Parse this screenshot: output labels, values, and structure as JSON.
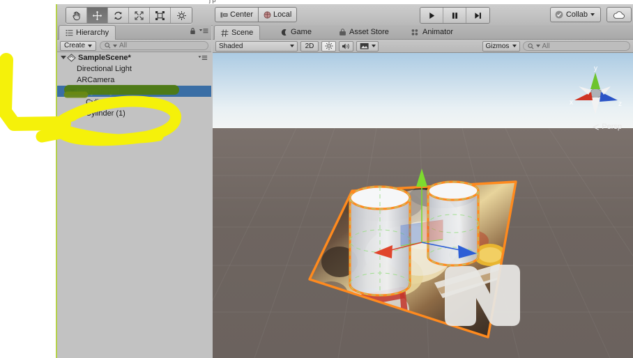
{
  "app": {
    "name": "Unity Editor",
    "ghost_text": "j p"
  },
  "toolbar": {
    "tools": [
      {
        "name": "hand-tool",
        "label": "Hand",
        "active": false
      },
      {
        "name": "move-tool",
        "label": "Move",
        "active": true
      },
      {
        "name": "rotate-tool",
        "label": "Rotate",
        "active": false
      },
      {
        "name": "scale-tool",
        "label": "Scale",
        "active": false
      },
      {
        "name": "rect-tool",
        "label": "Rect",
        "active": false
      },
      {
        "name": "transform-tool",
        "label": "Transform",
        "active": false
      }
    ],
    "pivot_label": "Center",
    "rotation_label": "Local",
    "play_label": "Play",
    "pause_label": "Pause",
    "step_label": "Step",
    "collab_label": "Collab",
    "cloud_label": "Services"
  },
  "hierarchy": {
    "tab_label": "Hierarchy",
    "create_label": "Create",
    "search_placeholder": "All",
    "search_value": "",
    "items": [
      {
        "label": "SampleScene*",
        "depth": 0,
        "selected": false,
        "expanded": true,
        "bold": true,
        "icon": "scene-icon"
      },
      {
        "label": "Directional Light",
        "depth": 1,
        "selected": false,
        "expanded": null,
        "bold": false,
        "icon": ""
      },
      {
        "label": "ARCamera",
        "depth": 1,
        "selected": false,
        "expanded": null,
        "bold": false,
        "icon": ""
      },
      {
        "label": "ImageTarget",
        "depth": 1,
        "selected": true,
        "expanded": true,
        "bold": false,
        "icon": ""
      },
      {
        "label": "Cylinder",
        "depth": 2,
        "selected": false,
        "expanded": null,
        "bold": false,
        "icon": ""
      },
      {
        "label": "Cylinder (1)",
        "depth": 2,
        "selected": false,
        "expanded": null,
        "bold": false,
        "icon": ""
      }
    ]
  },
  "scene_panel": {
    "tabs": [
      {
        "label": "Scene",
        "icon": "grid-icon",
        "active": true
      },
      {
        "label": "Game",
        "icon": "gamepad-icon",
        "active": false
      },
      {
        "label": "Asset Store",
        "icon": "store-icon",
        "active": false
      },
      {
        "label": "Animator",
        "icon": "animator-icon",
        "active": false
      }
    ],
    "shading_mode": "Shaded",
    "view_mode_2d": "2D",
    "lighting_label": "Lighting",
    "audio_label": "Audio",
    "effects_label": "Effects",
    "gizmos_label": "Gizmos",
    "search_placeholder": "All",
    "search_value": "",
    "projection_label": "Persp",
    "axis_labels": {
      "x": "x",
      "y": "y",
      "z": "z"
    }
  },
  "colors": {
    "selection_outline": "#ff8a1e",
    "selected_row": "#3a6ea5",
    "selected_row_text": "#9ad66b",
    "annotation": "#f5f10a",
    "annotation_over_row": "#4f7a10",
    "axis_x": "#e0452c",
    "axis_y": "#7ddb2e",
    "axis_z": "#2d5fd6",
    "panel_bg": "#c2c2c2",
    "window_edge": "#b5d14a"
  },
  "viewport": {
    "objects": [
      {
        "name": "image-target-plane",
        "type": "quad",
        "selected": true
      },
      {
        "name": "cylinder-left",
        "type": "cylinder",
        "selected": true
      },
      {
        "name": "cylinder-right",
        "type": "cylinder",
        "selected": true
      },
      {
        "name": "n-mesh",
        "type": "mesh",
        "selected": false
      }
    ],
    "gizmo_type": "move"
  },
  "annotation": {
    "type": "highlighter-marker",
    "strokes": [
      "arrow-left",
      "circle-around-cylinders"
    ]
  }
}
